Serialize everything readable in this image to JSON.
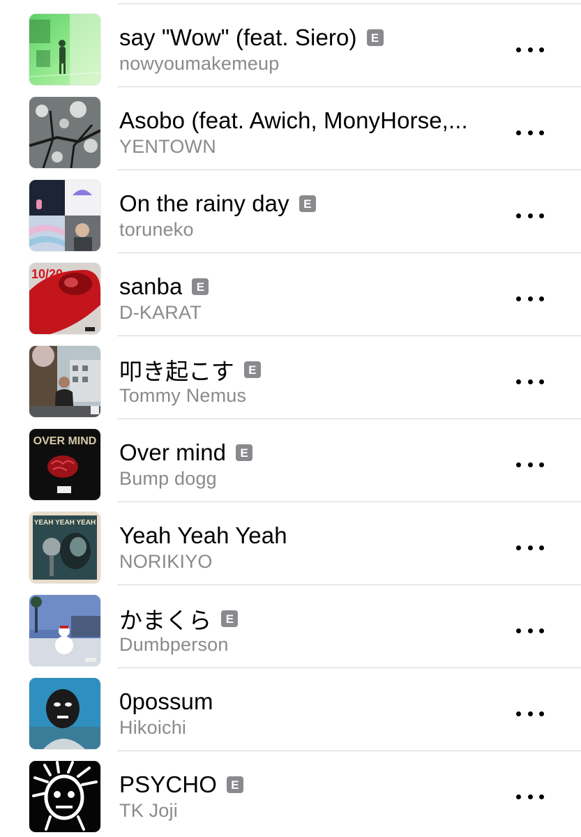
{
  "tracks": [
    {
      "title": "say \"Wow\" (feat. Siero)",
      "artist": "nowyoumakemeup",
      "explicit": "E",
      "cover_icon": "album-art-green-figure"
    },
    {
      "title": "Asobo (feat. Awich, MonyHorse,...",
      "artist": "YENTOWN",
      "explicit": "",
      "cover_icon": "album-art-cherry-blossom"
    },
    {
      "title": "On the rainy day",
      "artist": "toruneko",
      "explicit": "E",
      "cover_icon": "album-art-collage"
    },
    {
      "title": "sanba",
      "artist": "D-KARAT",
      "explicit": "E",
      "cover_icon": "album-art-red-bottle",
      "cover_text": "10/20"
    },
    {
      "title": "叩き起こす",
      "artist": "Tommy Nemus",
      "explicit": "E",
      "cover_icon": "album-art-street-portrait"
    },
    {
      "title": "Over mind",
      "artist": "Bump dogg",
      "explicit": "E",
      "cover_icon": "album-art-red-brain",
      "cover_text": "OVER MIND"
    },
    {
      "title": "Yeah Yeah Yeah",
      "artist": "NORIKIYO",
      "explicit": "",
      "cover_icon": "album-art-microphone",
      "cover_text": "YEAH YEAH YEAH"
    },
    {
      "title": "かまくら",
      "artist": "Dumbperson",
      "explicit": "E",
      "cover_icon": "album-art-snowman"
    },
    {
      "title": "0possum",
      "artist": "Hikoichi",
      "explicit": "",
      "cover_icon": "album-art-masked-face"
    },
    {
      "title": "PSYCHO",
      "artist": "TK Joji",
      "explicit": "E",
      "cover_icon": "album-art-white-sketch"
    }
  ],
  "more_icon": "more-options-icon",
  "colors": {
    "title": "#000000",
    "artist": "#8a8a8e",
    "explicit_badge": "#8a8a8e",
    "separator": "#d4d4d8"
  }
}
